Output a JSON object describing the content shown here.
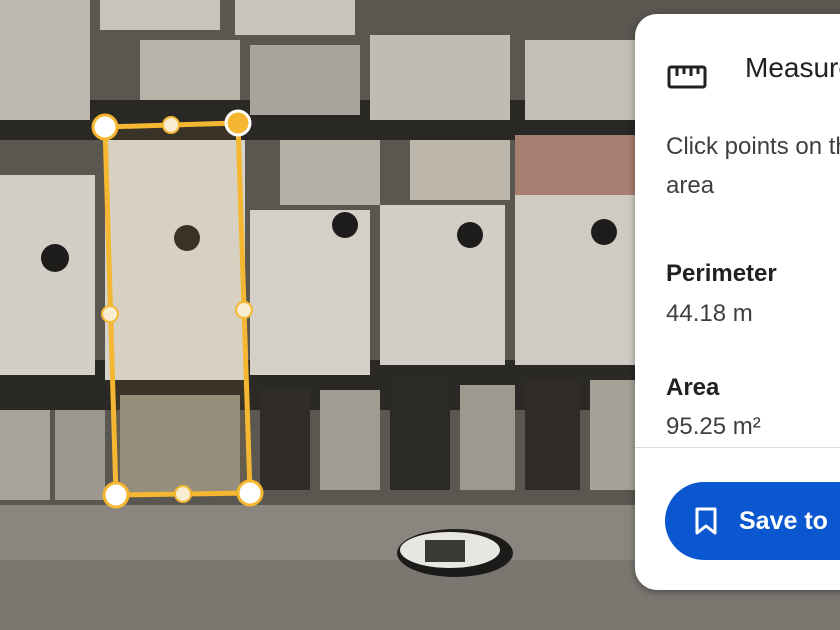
{
  "panel": {
    "icon": "ruler-icon",
    "title": "Measure distance",
    "hint_line1": "Click points on the map",
    "hint_line2": "area",
    "perimeter_label": "Perimeter",
    "perimeter_value": "44.18 m",
    "area_label": "Area",
    "area_value": "95.25 m²",
    "save_icon": "bookmark-icon",
    "save_label": "Save to"
  },
  "colors": {
    "measure_line": "#f5b731",
    "accent_button": "#0b57d0"
  }
}
